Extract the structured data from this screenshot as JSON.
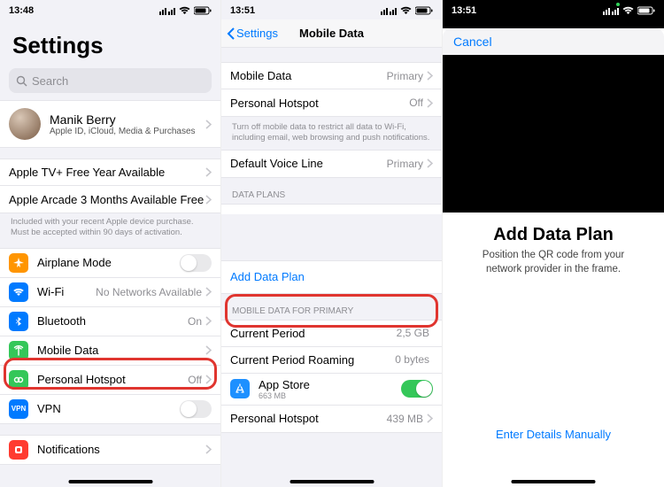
{
  "pane1": {
    "time": "13:48",
    "title": "Settings",
    "search_placeholder": "Search",
    "user": {
      "name": "Manik Berry",
      "sub": "Apple ID, iCloud, Media & Purchases"
    },
    "promo1": "Apple TV+ Free Year Available",
    "promo2": "Apple Arcade 3 Months Available Free",
    "promo_foot": "Included with your recent Apple device purchase. Must be accepted within 90 days of activation.",
    "airplane": "Airplane Mode",
    "wifi": "Wi-Fi",
    "wifi_detail": "No Networks Available",
    "bt": "Bluetooth",
    "bt_detail": "On",
    "mobile": "Mobile Data",
    "hotspot": "Personal Hotspot",
    "hotspot_detail": "Off",
    "vpn": "VPN",
    "vpn_badge": "VPN",
    "notifications": "Notifications"
  },
  "pane2": {
    "time": "13:51",
    "back": "Settings",
    "title": "Mobile Data",
    "rows": {
      "mobile": "Mobile Data",
      "mobile_detail": "Primary",
      "hotspot": "Personal Hotspot",
      "hotspot_detail": "Off",
      "foot": "Turn off mobile data to restrict all data to Wi-Fi, including email, web browsing and push notifications.",
      "voice": "Default Voice Line",
      "voice_detail": "Primary"
    },
    "sect_plans": "DATA PLANS",
    "add_plan": "Add Data Plan",
    "sect_primary": "MOBILE DATA FOR PRIMARY",
    "period": "Current Period",
    "period_v": "2,5 GB",
    "roaming": "Current Period Roaming",
    "roaming_v": "0 bytes",
    "appstore": "App Store",
    "appstore_sub": "663 MB",
    "personal_hs": "Personal Hotspot",
    "personal_hs_v": "439 MB"
  },
  "pane3": {
    "time": "13:51",
    "cancel": "Cancel",
    "title": "Add Data Plan",
    "sub": "Position the QR code from your network provider in the frame.",
    "manual": "Enter Details Manually"
  }
}
